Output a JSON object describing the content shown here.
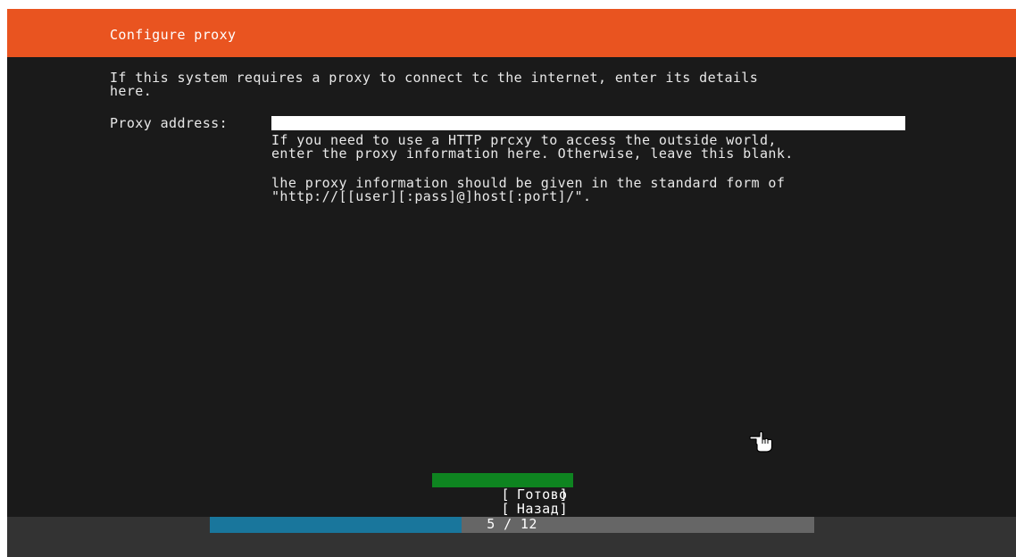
{
  "header": {
    "title": "Configure proxy"
  },
  "intro": {
    "text": "If this system requires a proxy to connect tc the internet, enter its details\nhere."
  },
  "proxy_field": {
    "label": "Proxy address:",
    "value": "",
    "help_1": "If you need to use a HTTP prcxy to access the outside world,\nenter the proxy information here. Otherwise, leave this blank.",
    "help_2": "lhe proxy information should be given in the standard form of\n\"http://[[user][:pass]@]host[:port]/\"."
  },
  "buttons": {
    "done_label": "Готово",
    "back_label": "Назад"
  },
  "progress": {
    "current": 5,
    "total": 12,
    "text": "5 / 12",
    "fraction": 0.4167
  },
  "colors": {
    "header": "#e95420",
    "done_button": "#0e8420",
    "progress_fill": "#19769c"
  },
  "icons": {
    "pointer": "hand-pointer-icon"
  }
}
